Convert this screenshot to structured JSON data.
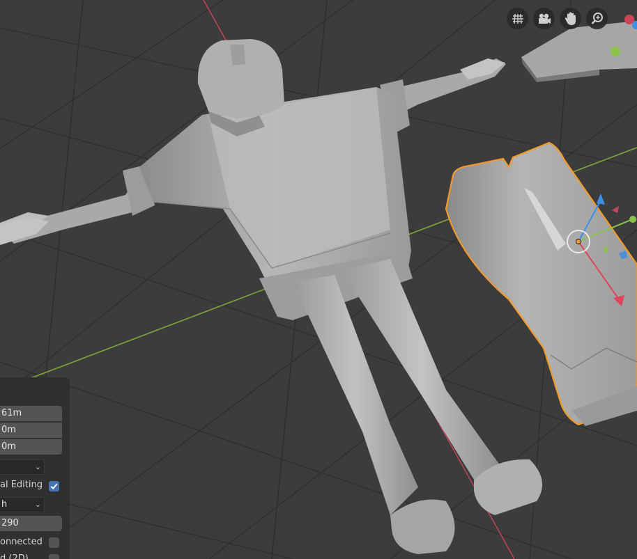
{
  "viewport": {
    "nav_icons": [
      "grid-icon",
      "camera-icon",
      "hand-pan-icon",
      "zoom-icon"
    ],
    "colors": {
      "background": "#3c3c3c",
      "grid": "#2f2f2f",
      "x_axis": "#c94457",
      "y_axis": "#7ca83a",
      "selection_outline": "#f09a2b",
      "gizmo_x": "#e0455b",
      "gizmo_y": "#8bc34a",
      "gizmo_z": "#3d8ee6"
    }
  },
  "panel": {
    "fields": [
      "61m",
      "0m",
      "0m"
    ],
    "dropdown_1": "",
    "proportional_label": "al Editing",
    "proportional_checked": true,
    "dropdown_2": "h",
    "size_value": "290",
    "connected_label": "onnected",
    "connected_checked": false,
    "projected_label": "d (2D)",
    "projected_checked": false
  }
}
